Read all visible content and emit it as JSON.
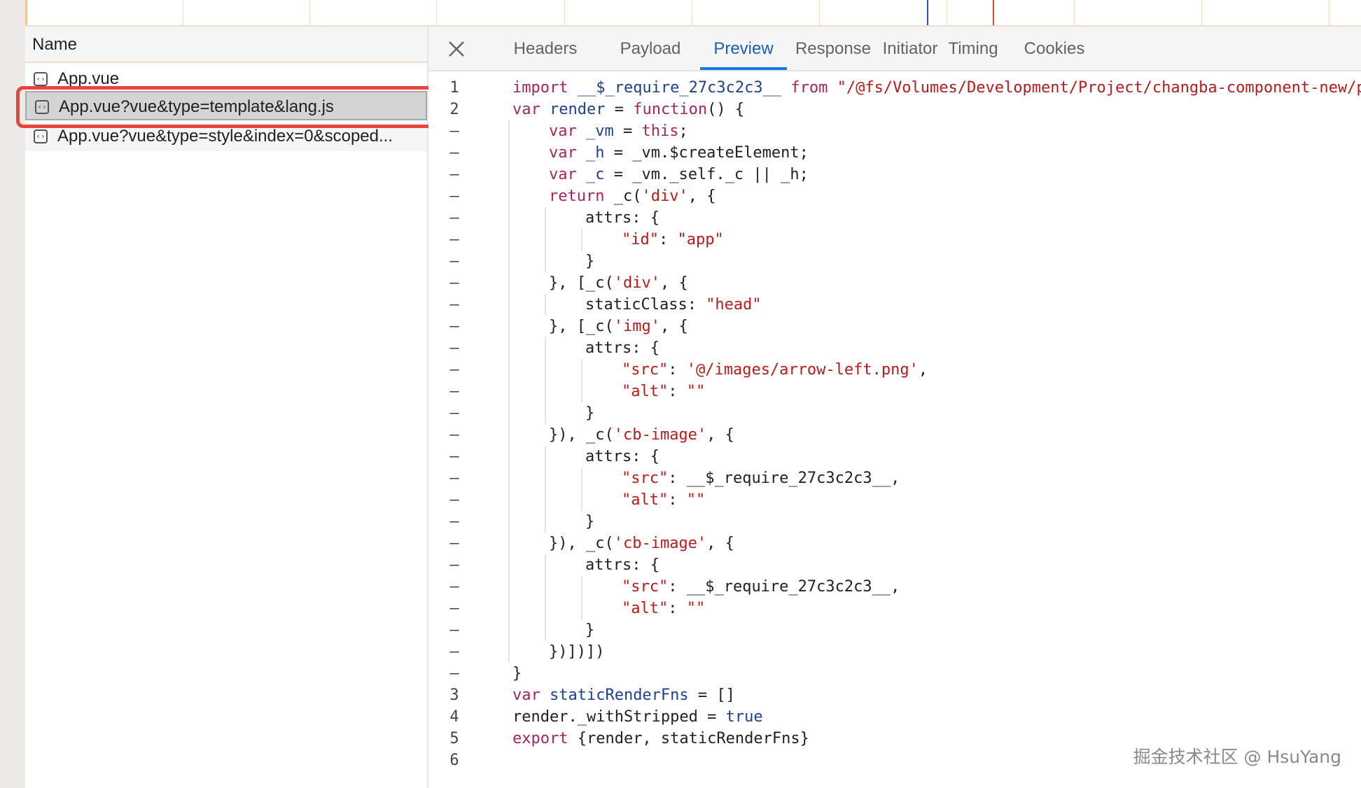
{
  "timeline": {
    "colors": {
      "grid": "#f1dcc7",
      "blue_marker": "#2f4fd3",
      "red_marker": "#d9463a"
    }
  },
  "network": {
    "name_header": "Name",
    "requests": [
      {
        "name": "App.vue",
        "icon": "script-file-icon"
      },
      {
        "name": "App.vue?vue&type=template&lang.js",
        "icon": "script-file-icon",
        "selected": true,
        "highlighted": true
      },
      {
        "name": "App.vue?vue&type=style&index=0&scoped...",
        "icon": "script-file-icon"
      }
    ],
    "highlight_color": "#e8453c"
  },
  "detail": {
    "tabs": [
      {
        "label": "Headers"
      },
      {
        "label": "Payload"
      },
      {
        "label": "Preview",
        "active": true
      },
      {
        "label": "Response"
      },
      {
        "label": "Initiator"
      },
      {
        "label": "Timing"
      },
      {
        "label": "Cookies"
      }
    ],
    "accent": "#1a73e8",
    "code_lines": [
      {
        "num": "1",
        "indent": 0,
        "tokens": [
          [
            "kw",
            "import "
          ],
          [
            "var",
            "__$_require_27c3c2c3__ "
          ],
          [
            "kw",
            "from "
          ],
          [
            "str",
            "\"/@fs/Volumes/Development/Project/changba-component-new/p"
          ]
        ]
      },
      {
        "num": "2",
        "indent": 0,
        "tokens": [
          [
            "kw",
            "var "
          ],
          [
            "var",
            "render "
          ],
          [
            "pl",
            "= "
          ],
          [
            "kw",
            "function"
          ],
          [
            "pl",
            "() {"
          ]
        ]
      },
      {
        "num": "–",
        "indent": 1,
        "tokens": [
          [
            "kw",
            "var "
          ],
          [
            "var",
            "_vm "
          ],
          [
            "pl",
            "= "
          ],
          [
            "kw",
            "this"
          ],
          [
            "pl",
            ";"
          ]
        ]
      },
      {
        "num": "–",
        "indent": 1,
        "tokens": [
          [
            "kw",
            "var "
          ],
          [
            "var",
            "_h "
          ],
          [
            "pl",
            "= _vm.$createElement;"
          ]
        ]
      },
      {
        "num": "–",
        "indent": 1,
        "tokens": [
          [
            "kw",
            "var "
          ],
          [
            "var",
            "_c "
          ],
          [
            "pl",
            "= _vm._self._c || _h;"
          ]
        ]
      },
      {
        "num": "–",
        "indent": 1,
        "tokens": [
          [
            "kw",
            "return "
          ],
          [
            "pl",
            "_c("
          ],
          [
            "str",
            "'div'"
          ],
          [
            "pl",
            ", {"
          ]
        ]
      },
      {
        "num": "–",
        "indent": 2,
        "tokens": [
          [
            "pl",
            "attrs: {"
          ]
        ]
      },
      {
        "num": "–",
        "indent": 3,
        "tokens": [
          [
            "str",
            "\"id\""
          ],
          [
            "pl",
            ": "
          ],
          [
            "str",
            "\"app\""
          ]
        ]
      },
      {
        "num": "–",
        "indent": 2,
        "tokens": [
          [
            "pl",
            "}"
          ]
        ]
      },
      {
        "num": "–",
        "indent": 1,
        "tokens": [
          [
            "pl",
            "}, [_c("
          ],
          [
            "str",
            "'div'"
          ],
          [
            "pl",
            ", {"
          ]
        ]
      },
      {
        "num": "–",
        "indent": 2,
        "tokens": [
          [
            "pl",
            "staticClass: "
          ],
          [
            "str",
            "\"head\""
          ]
        ]
      },
      {
        "num": "–",
        "indent": 1,
        "tokens": [
          [
            "pl",
            "}, [_c("
          ],
          [
            "str",
            "'img'"
          ],
          [
            "pl",
            ", {"
          ]
        ]
      },
      {
        "num": "–",
        "indent": 2,
        "tokens": [
          [
            "pl",
            "attrs: {"
          ]
        ]
      },
      {
        "num": "–",
        "indent": 3,
        "tokens": [
          [
            "str",
            "\"src\""
          ],
          [
            "pl",
            ": "
          ],
          [
            "str",
            "'@/images/arrow-left.png'"
          ],
          [
            "pl",
            ","
          ]
        ]
      },
      {
        "num": "–",
        "indent": 3,
        "tokens": [
          [
            "str",
            "\"alt\""
          ],
          [
            "pl",
            ": "
          ],
          [
            "str",
            "\"\""
          ]
        ]
      },
      {
        "num": "–",
        "indent": 2,
        "tokens": [
          [
            "pl",
            "}"
          ]
        ]
      },
      {
        "num": "–",
        "indent": 1,
        "tokens": [
          [
            "pl",
            "}), _c("
          ],
          [
            "str",
            "'cb-image'"
          ],
          [
            "pl",
            ", {"
          ]
        ]
      },
      {
        "num": "–",
        "indent": 2,
        "tokens": [
          [
            "pl",
            "attrs: {"
          ]
        ]
      },
      {
        "num": "–",
        "indent": 3,
        "tokens": [
          [
            "str",
            "\"src\""
          ],
          [
            "pl",
            ": __$_require_27c3c2c3__,"
          ]
        ]
      },
      {
        "num": "–",
        "indent": 3,
        "tokens": [
          [
            "str",
            "\"alt\""
          ],
          [
            "pl",
            ": "
          ],
          [
            "str",
            "\"\""
          ]
        ]
      },
      {
        "num": "–",
        "indent": 2,
        "tokens": [
          [
            "pl",
            "}"
          ]
        ]
      },
      {
        "num": "–",
        "indent": 1,
        "tokens": [
          [
            "pl",
            "}), _c("
          ],
          [
            "str",
            "'cb-image'"
          ],
          [
            "pl",
            ", {"
          ]
        ]
      },
      {
        "num": "–",
        "indent": 2,
        "tokens": [
          [
            "pl",
            "attrs: {"
          ]
        ]
      },
      {
        "num": "–",
        "indent": 3,
        "tokens": [
          [
            "str",
            "\"src\""
          ],
          [
            "pl",
            ": __$_require_27c3c2c3__,"
          ]
        ]
      },
      {
        "num": "–",
        "indent": 3,
        "tokens": [
          [
            "str",
            "\"alt\""
          ],
          [
            "pl",
            ": "
          ],
          [
            "str",
            "\"\""
          ]
        ]
      },
      {
        "num": "–",
        "indent": 2,
        "tokens": [
          [
            "pl",
            "}"
          ]
        ]
      },
      {
        "num": "–",
        "indent": 1,
        "tokens": [
          [
            "pl",
            "})])])"
          ]
        ]
      },
      {
        "num": "–",
        "indent": 0,
        "tokens": [
          [
            "pl",
            "}"
          ]
        ]
      },
      {
        "num": "3",
        "indent": 0,
        "tokens": [
          [
            "kw",
            "var "
          ],
          [
            "var",
            "staticRenderFns "
          ],
          [
            "pl",
            "= []"
          ]
        ]
      },
      {
        "num": "4",
        "indent": 0,
        "tokens": [
          [
            "pl",
            "render._withStripped = "
          ],
          [
            "var",
            "true"
          ]
        ]
      },
      {
        "num": "5",
        "indent": 0,
        "tokens": [
          [
            "kw",
            "export "
          ],
          [
            "pl",
            "{render, staticRenderFns}"
          ]
        ]
      },
      {
        "num": "6",
        "indent": 0,
        "tokens": []
      }
    ]
  },
  "watermark": "掘金技术社区 @ HsuYang"
}
